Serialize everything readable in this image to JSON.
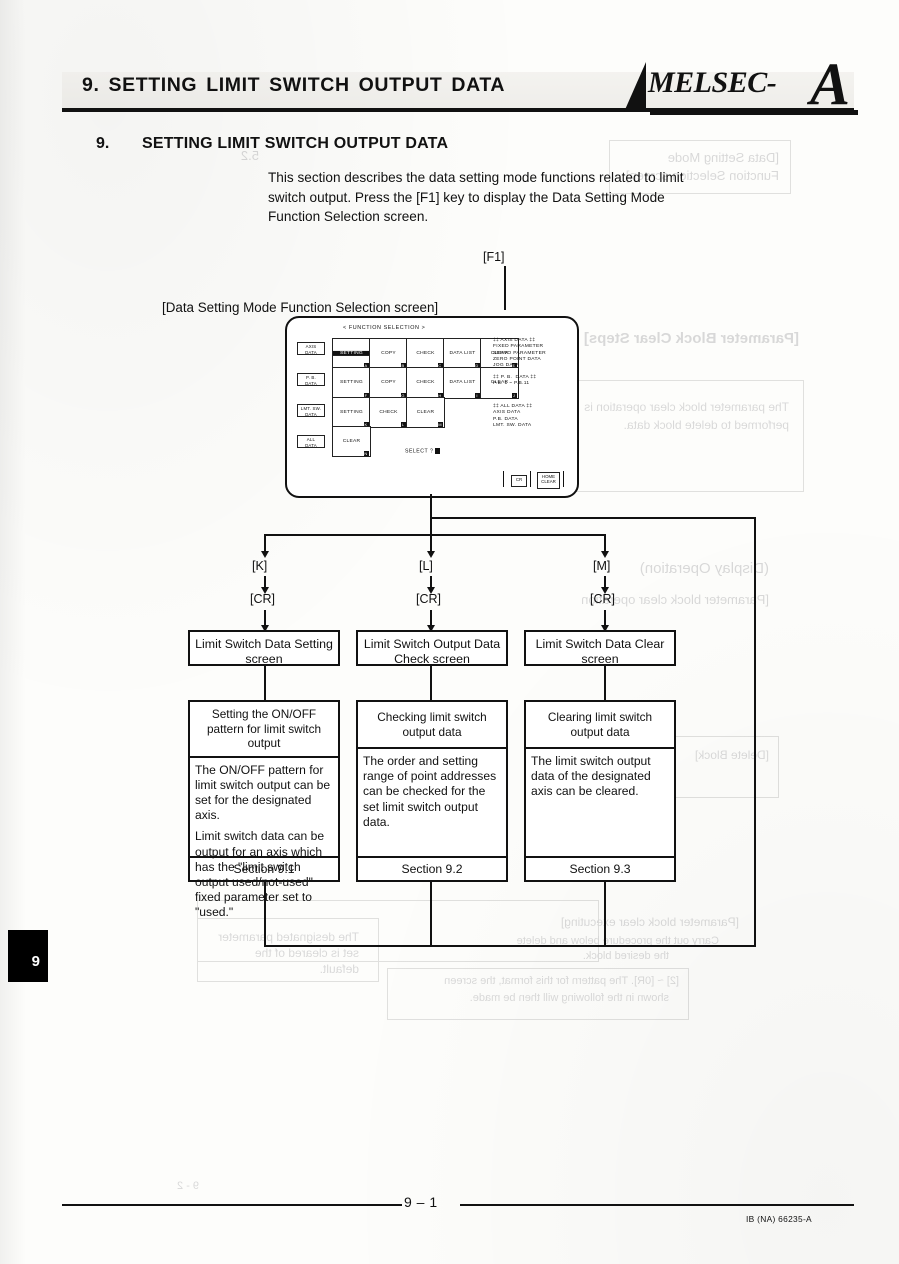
{
  "header": {
    "running_title": "9.  SETTING  LIMIT  SWITCH  OUTPUT  DATA",
    "brand_word": "MELSEC-",
    "brand_letter": "A"
  },
  "section": {
    "number": "9.",
    "title": "SETTING LIMIT SWITCH OUTPUT DATA",
    "intro_line1": "This section describes the data setting mode functions related to limit",
    "intro_line2": "switch output.   Press the [F1] key to display the Data Setting Mode",
    "intro_line3": "Function Selection screen."
  },
  "flow": {
    "f1_key": "[F1]",
    "screen_caption": "[Data Setting Mode Function Selection screen]",
    "branches": [
      {
        "key": "[K]",
        "cr": "[CR]"
      },
      {
        "key": "[L]",
        "cr": "[CR]"
      },
      {
        "key": "[M]",
        "cr": "[CR]"
      }
    ],
    "screens": [
      {
        "line1": "Limit Switch Data Setting",
        "line2": "screen"
      },
      {
        "line1": "Limit Switch Output Data",
        "line2": "Check screen"
      },
      {
        "line1": "Limit Switch Data Clear",
        "line2": "screen"
      }
    ],
    "details": [
      {
        "head": "Setting the ON/OFF pattern for limit switch output",
        "body1": "The ON/OFF pattern for limit switch output can be set for the designated axis.",
        "body2": "Limit switch data can be output for an axis which has the \"limit switch output used/not-used\" fixed parameter set to \"used.\"",
        "foot": "Section 9.1"
      },
      {
        "head": "Checking limit switch output data",
        "body1": "The order and setting range of point addresses can be checked for the set limit switch output data.",
        "body2": "",
        "foot": "Section 9.2"
      },
      {
        "head": "Clearing limit switch output data",
        "body1": "The limit switch output data of the designated axis can be cleared.",
        "body2": "",
        "foot": "Section 9.3"
      }
    ]
  },
  "crt": {
    "title": "< FUNCTION SELECTION >",
    "row_labels": [
      {
        "l1": "AXIS",
        "l2": "DATA"
      },
      {
        "l1": "P. B.",
        "l2": "DATA"
      },
      {
        "l1": "LMT. SW.",
        "l2": "DATA"
      },
      {
        "l1": "ALL",
        "l2": "DATA"
      }
    ],
    "rows": [
      [
        {
          "label": "SETTING",
          "key": "A",
          "selected": true
        },
        {
          "label": "COPY",
          "key": "B",
          "selected": false
        },
        {
          "label": "CHECK",
          "key": "C",
          "selected": false
        },
        {
          "label": "DATA LIST",
          "key": "D",
          "selected": false
        },
        {
          "label": "CLEAR",
          "key": "E",
          "selected": false
        }
      ],
      [
        {
          "label": "SETTING",
          "key": "F",
          "selected": false
        },
        {
          "label": "COPY",
          "key": "G",
          "selected": false
        },
        {
          "label": "CHECK",
          "key": "H",
          "selected": false
        },
        {
          "label": "DATA LIST",
          "key": "I",
          "selected": false
        },
        {
          "label": "CLEAR",
          "key": "J",
          "selected": false
        }
      ],
      [
        {
          "label": "SETTING",
          "key": "K",
          "selected": false
        },
        {
          "label": "CHECK",
          "key": "L",
          "selected": false
        },
        {
          "label": "CLEAR",
          "key": "M",
          "selected": false
        }
      ],
      [
        {
          "label": "CLEAR",
          "key": "N",
          "selected": false
        }
      ]
    ],
    "side_axis": "‡‡ AXIS DATA ‡‡\nFIXED PARAMETER\nSERVO PARAMETER\nZERO POINT DATA\nJOG DATA",
    "side_pb": "‡‡ P. B.  DATA ‡‡\nP.B. 1 ~ P.B.11",
    "side_all": "‡‡ ALL DATA ‡‡\nAXIS DATA\nP.B. DATA\nLMT. SW. DATA",
    "select_prompt": "SELECT ?",
    "fkey_cr": "CR",
    "fkey_home": "HOME\nCLEAR"
  },
  "footer": {
    "page": "9 – 1",
    "doc_code": "IB (NA) 66235-A"
  },
  "chapter_tab": "9"
}
